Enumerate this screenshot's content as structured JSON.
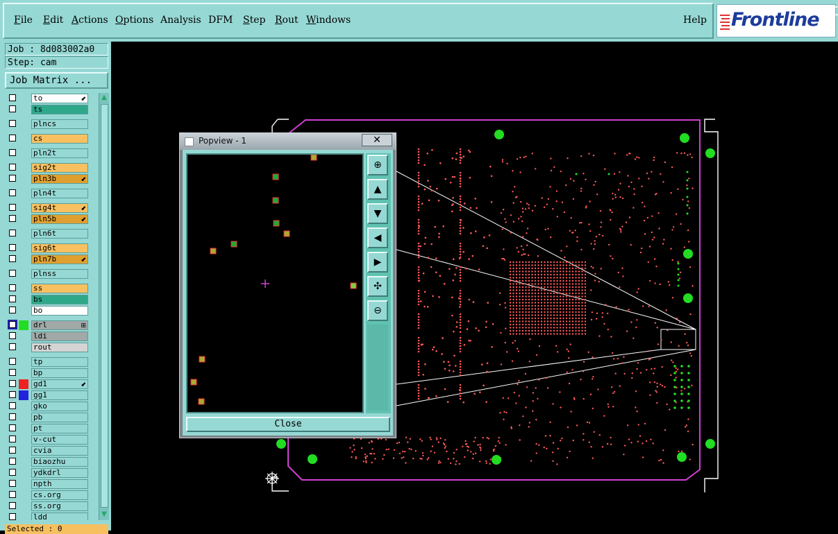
{
  "menubar": {
    "items": [
      "File",
      "Edit",
      "Actions",
      "Options",
      "Analysis",
      "DFM",
      "Step",
      "Rout",
      "Windows"
    ],
    "help": "Help",
    "logo": "Frontline"
  },
  "job": {
    "job_label": "Job : 8d083002a0",
    "step_label": "Step: cam",
    "matrix_button": "Job Matrix ..."
  },
  "layers": [
    {
      "name": "to",
      "color": "#ffffff",
      "mark": "⬋"
    },
    {
      "name": "ts",
      "color": "#2fa88a"
    },
    {
      "name": "plncs",
      "color": "#96d8d4"
    },
    {
      "name": "cs",
      "color": "#f8c060"
    },
    {
      "name": "pln2t",
      "color": "#96d8d4"
    },
    {
      "name": "sig2t",
      "color": "#f8c060"
    },
    {
      "name": "pln3b",
      "color": "#e0a030",
      "mark": "⬋"
    },
    {
      "name": "pln4t",
      "color": "#96d8d4"
    },
    {
      "name": "sig4t",
      "color": "#f8c060",
      "mark": "⬋"
    },
    {
      "name": "pln5b",
      "color": "#e0a030",
      "mark": "⬋"
    },
    {
      "name": "pln6t",
      "color": "#96d8d4"
    },
    {
      "name": "sig6t",
      "color": "#f8c060"
    },
    {
      "name": "pln7b",
      "color": "#e0a030",
      "mark": "⬋"
    },
    {
      "name": "plnss",
      "color": "#96d8d4"
    },
    {
      "name": "ss",
      "color": "#f8c060"
    },
    {
      "name": "bs",
      "color": "#2fa88a"
    },
    {
      "name": "bo",
      "color": "#ffffff"
    },
    {
      "name": "drl",
      "color": "#a0a8a8",
      "mark": "⊞",
      "swatch": "#22dd22",
      "checked": true
    },
    {
      "name": "ldi",
      "color": "#a0a8a8"
    },
    {
      "name": "rout",
      "color": "#d4d4d4"
    },
    {
      "name": "tp",
      "color": "#96d8d4"
    },
    {
      "name": "bp",
      "color": "#96d8d4"
    },
    {
      "name": "gd1",
      "color": "#96d8d4",
      "mark": "⬋",
      "swatch": "#ee2222"
    },
    {
      "name": "gg1",
      "color": "#96d8d4",
      "swatch": "#2222dd"
    },
    {
      "name": "gko",
      "color": "#96d8d4"
    },
    {
      "name": "pb",
      "color": "#96d8d4"
    },
    {
      "name": "pt",
      "color": "#96d8d4"
    },
    {
      "name": "v-cut",
      "color": "#96d8d4"
    },
    {
      "name": "cvia",
      "color": "#96d8d4"
    },
    {
      "name": "biaozhu",
      "color": "#96d8d4"
    },
    {
      "name": "ydkdrl",
      "color": "#96d8d4"
    },
    {
      "name": "npth",
      "color": "#96d8d4"
    },
    {
      "name": "cs.org",
      "color": "#96d8d4"
    },
    {
      "name": "ss.org",
      "color": "#96d8d4"
    },
    {
      "name": "ldd",
      "color": "#96d8d4"
    }
  ],
  "status": {
    "selected": "Selected : 0"
  },
  "popview": {
    "title": "Popview - 1",
    "close_x": "✕",
    "close_button": "Close"
  },
  "colors": {
    "panel": "#96d8d4",
    "pad": "#ff5a5a",
    "drill": "#22dd22",
    "outline": "#d040d0"
  },
  "icons": [
    "zoom-in-icon",
    "pan-up-icon",
    "pan-down-icon",
    "pan-left-icon",
    "pan-right-icon",
    "zoom-fit-icon",
    "zoom-out-icon"
  ]
}
